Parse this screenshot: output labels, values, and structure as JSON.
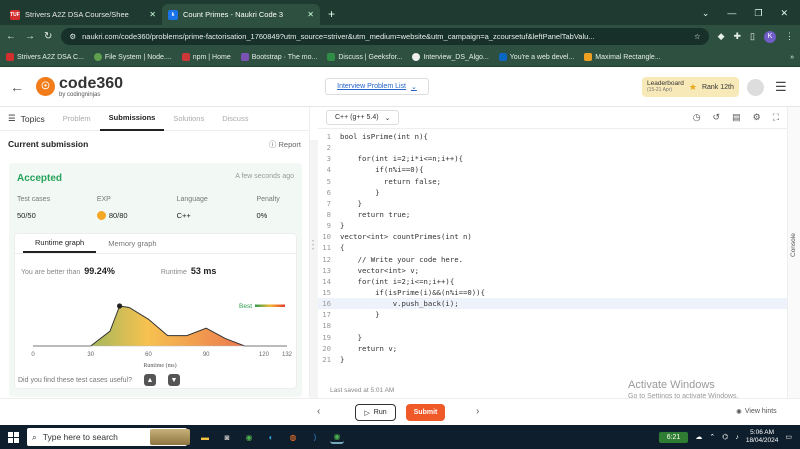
{
  "browser": {
    "tabs": [
      {
        "label": "Strivers A2Z DSA Course/Shee",
        "favicon": "TUF",
        "color": "#d32f2f",
        "active": false
      },
      {
        "label": "Count Primes - Naukri Code 3",
        "favicon": "k",
        "color": "#1a73e8",
        "active": true
      }
    ],
    "url": "naukri.com/code360/problems/prime-factorisation_1760849?utm_source=striver&utm_medium=website&utm_campaign=a_zcoursetuf&leftPanelTabValu...",
    "bookmarks": [
      "Strivers A2Z DSA C...",
      "File System | Node....",
      "npm | Home",
      "Bootstrap · The mo...",
      "Discuss | Geeksfor...",
      "Interview_DS_Algo...",
      "You're a web devel...",
      "Maximal Rectangle..."
    ],
    "profile_initial": "K"
  },
  "header": {
    "logo_main": "code360",
    "logo_sub": "by codingninjas",
    "problem_list": "Interview Problem List",
    "leaderboard_title": "Leaderboard",
    "leaderboard_dates": "(15-21 Apr)",
    "rank": "Rank 12th"
  },
  "left": {
    "topics": "Topics",
    "tabs": [
      "Problem",
      "Submissions",
      "Solutions",
      "Discuss"
    ],
    "active_tab": "Submissions",
    "current_submission": "Current submission",
    "report": "Report",
    "status": "Accepted",
    "time_ago": "A few seconds ago",
    "stats": [
      {
        "label": "Test cases",
        "value": "50/50"
      },
      {
        "label": "EXP",
        "value": "80/80"
      },
      {
        "label": "Language",
        "value": "C++"
      },
      {
        "label": "Penalty",
        "value": "0%"
      }
    ],
    "graph_tabs": [
      "Runtime graph",
      "Memory graph"
    ],
    "beat_label": "You are better than",
    "beat_value": "99.24%",
    "runtime_label": "Runtime",
    "runtime_value": "53 ms",
    "help_text": "Did you find these test cases useful?"
  },
  "chart_data": {
    "type": "area",
    "x": [
      0,
      30,
      40,
      45,
      50,
      60,
      70,
      80,
      90,
      100,
      110,
      120,
      132
    ],
    "y": [
      0,
      0,
      10,
      27,
      26,
      18,
      7,
      7,
      12,
      5,
      0,
      0,
      0
    ],
    "xticks": [
      0,
      30,
      60,
      90,
      120,
      132
    ],
    "xlabel": "Runtime (ms)",
    "xlim": [
      0,
      132
    ],
    "legend": "Best",
    "marker_x": 45,
    "colors": {
      "best": "#2e9e4f",
      "mid": "#f5b731",
      "worst": "#e23b2e"
    }
  },
  "editor": {
    "language": "C++ (g++ 5.4)",
    "lines": [
      "bool isPrime(int n){",
      "",
      "    for(int i=2;i*i<=n;i++){",
      "        if(n%i==0){",
      "          return false;",
      "        }",
      "    }",
      "    return true;",
      "}",
      "vector<int> countPrimes(int n)",
      "{",
      "    // Write your code here.",
      "    vector<int> v;",
      "    for(int i=2;i<=n;i++){",
      "        if(isPrime(i)&&(n%i==0)){",
      "            v.push_back(i);",
      "        }",
      "",
      "    }",
      "    return v;",
      "}"
    ],
    "highlight_line": 16,
    "saved": "Last saved at 5:01 AM",
    "console": "Console"
  },
  "watermark": {
    "line1": "Activate Windows",
    "line2": "Go to Settings to activate Windows."
  },
  "actions": {
    "run": "Run",
    "submit": "Submit",
    "hints": "View hints"
  },
  "taskbar": {
    "search": "Type here to search",
    "timer": "6:21",
    "time": "5:06 AM",
    "date": "18/04/2024"
  }
}
